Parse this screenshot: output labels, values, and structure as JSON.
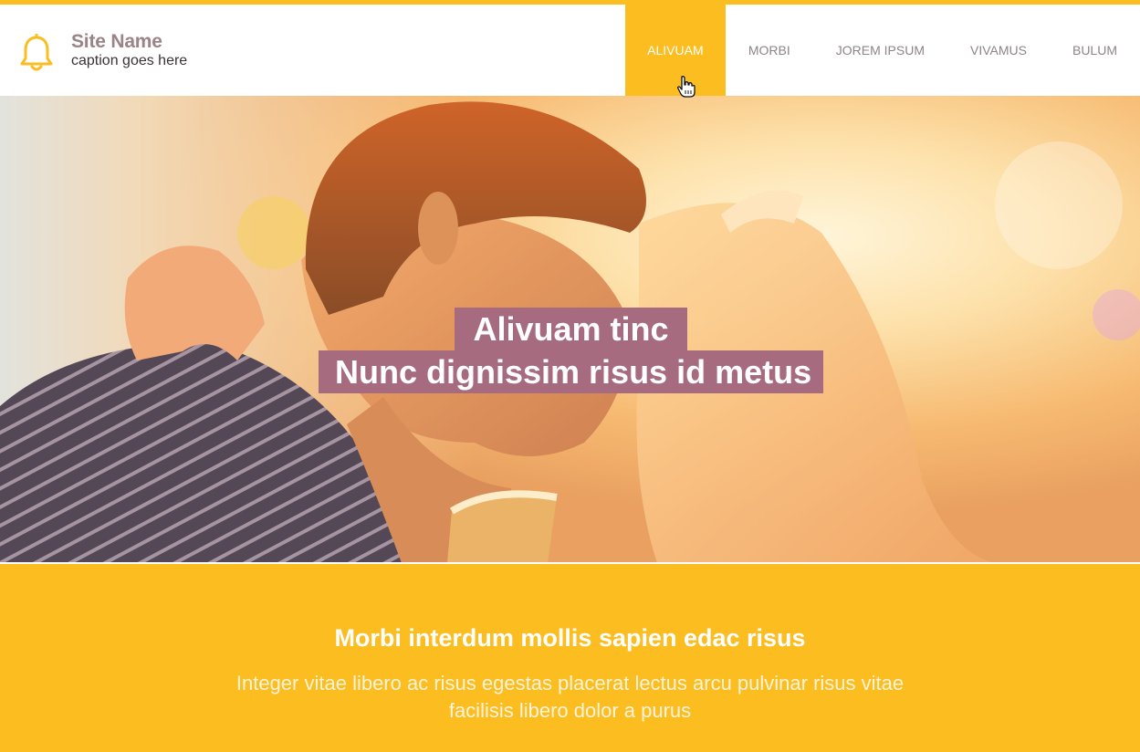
{
  "brand": {
    "site_name": "Site Name",
    "caption": "caption goes here",
    "logo_icon": "bell-icon",
    "accent_color": "#fbbd1f",
    "highlight_color": "#a76b7f"
  },
  "nav": {
    "items": [
      {
        "label": "ALIVUAM",
        "active": true
      },
      {
        "label": "MORBI",
        "active": false
      },
      {
        "label": "JOREM IPSUM",
        "active": false
      },
      {
        "label": "VIVAMUS",
        "active": false
      },
      {
        "label": "BULUM",
        "active": false
      }
    ]
  },
  "hero": {
    "line1": "Alivuam tinc",
    "line2": "Nunc dignissim risus id metus"
  },
  "promo": {
    "title": "Morbi interdum mollis sapien edac risus",
    "text": "Integer vitae libero ac risus egestas placerat lectus arcu pulvinar risus vitae facilisis libero dolor a purus"
  }
}
